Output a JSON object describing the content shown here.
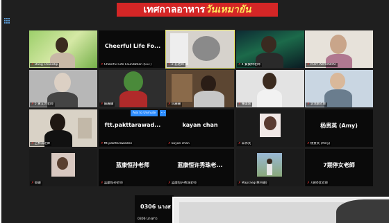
{
  "banner": {
    "title": "เทศกาลอาหาร",
    "subtitle": "วันเหมายัน"
  },
  "unmute_button": "Ask to Unmute",
  "more_button": "···",
  "participants": [
    {
      "name": "Dang Chanatip",
      "display": ""
    },
    {
      "name": "Cheerful Life Foundation (CLF)",
      "display": "Cheerful Life Fo..."
    },
    {
      "name": "2 孔老師",
      "display": ""
    },
    {
      "name": "4 賢賢林老師",
      "display": ""
    },
    {
      "name": "PLOY WIMONRAT",
      "display": ""
    },
    {
      "name": "5 黃艾玲老師",
      "display": ""
    },
    {
      "name": "蘇麗鑽",
      "display": ""
    },
    {
      "name": "阮麗麗",
      "display": ""
    },
    {
      "name": "陳美容",
      "display": ""
    },
    {
      "name": "李瑞麟老師",
      "display": ""
    },
    {
      "name": "上林海老師",
      "display": ""
    },
    {
      "name": "ftt.pakttarawadee",
      "display": "ftt.pakttarawad..."
    },
    {
      "name": "kayan chan",
      "display": "kayan chan"
    },
    {
      "name": "朱伟英",
      "display": ""
    },
    {
      "name": "杨贵英 (Amy)",
      "display": "杨贵英 (Amy)"
    },
    {
      "name": "蔡娥",
      "display": ""
    },
    {
      "name": "蓝康恒孙老师",
      "display": "蓝康恒孙老师"
    },
    {
      "name": "蓝康恒许秀珠老师",
      "display": "蓝康恒许秀珠老..."
    },
    {
      "name": "Mapraeg(林月娥)",
      "display": ""
    },
    {
      "name": "7期停女老師",
      "display": "7期停女老師"
    }
  ],
  "active_speaker": {
    "display": "0306 นางส",
    "name": "0306 นางสาว"
  },
  "colors": {
    "banner": "#d42626",
    "banner_sub": "#ffe55a",
    "unmute": "#2d8cff",
    "muted_mic": "#e53935",
    "highlight": "#e8e868"
  },
  "icons": {
    "layout": "grid-icon",
    "mic": "muted-mic-icon"
  }
}
